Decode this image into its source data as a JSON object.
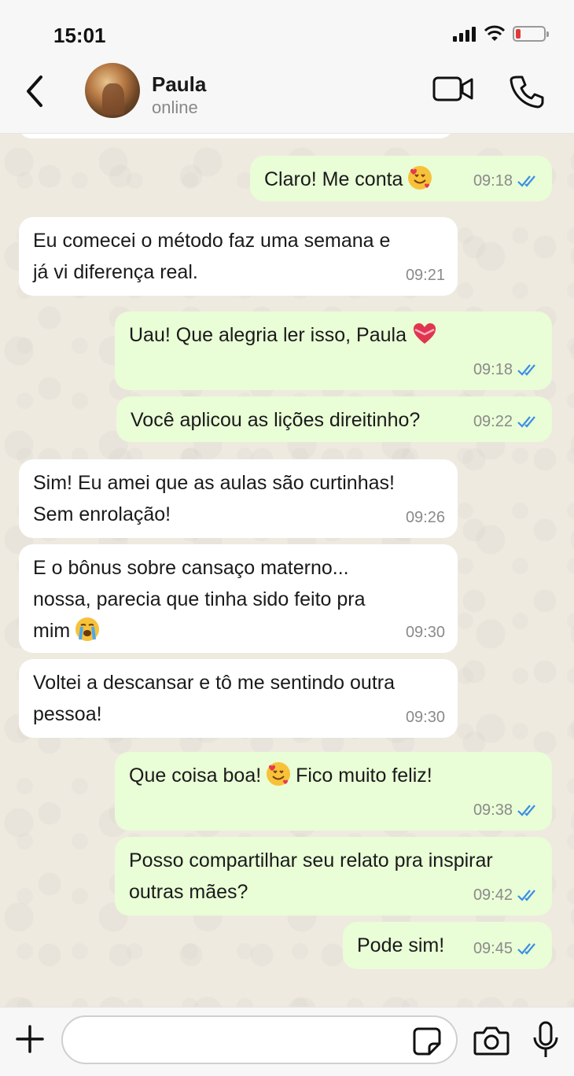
{
  "status_bar": {
    "time": "15:01"
  },
  "header": {
    "contact_name": "Paula",
    "contact_status": "online"
  },
  "messages": [
    {
      "direction": "out",
      "text": "Claro! Me conta",
      "emoji": "smiling-face-with-hearts",
      "time": "09:18",
      "ticks": "read"
    },
    {
      "direction": "in",
      "text": "Eu comecei o método faz uma semana e\njá vi diferença real.",
      "time": "09:21"
    },
    {
      "direction": "out",
      "text": "Uau! Que alegria ler isso, Paula",
      "emoji": "heart-with-ribbon",
      "time": "09:18",
      "ticks": "read"
    },
    {
      "direction": "out",
      "text": "Você aplicou as lições direitinho?",
      "time": "09:22",
      "ticks": "read"
    },
    {
      "direction": "in",
      "text": "Sim! Eu amei que as aulas são curtinhas!\nSem enrolação!",
      "time": "09:26"
    },
    {
      "direction": "in",
      "text": "E o bônus sobre cansaço materno...\nnossa, parecia que tinha sido feito pra\nmim",
      "emoji": "loudly-crying-face",
      "time": "09:30"
    },
    {
      "direction": "in",
      "text": "Voltei a descansar e tô me sentindo outra\npessoa!",
      "time": "09:30"
    },
    {
      "direction": "out",
      "text_before": "Que coisa boa!",
      "emoji": "smiling-face-with-hearts",
      "text_after": "Fico muito feliz!",
      "time": "09:38",
      "ticks": "read"
    },
    {
      "direction": "out",
      "text": "Posso compartilhar seu relato pra inspirar\noutras mães?",
      "time": "09:42",
      "ticks": "read"
    },
    {
      "direction": "out",
      "text": "Pode sim!",
      "time": "09:45",
      "ticks": "read"
    }
  ],
  "composer": {
    "placeholder": ""
  },
  "colors": {
    "incoming_bubble": "#ffffff",
    "outgoing_bubble": "#e9fdd6",
    "read_ticks": "#3a8ee6",
    "wallpaper": "#efeae0",
    "battery_low": "#e03a3a"
  }
}
